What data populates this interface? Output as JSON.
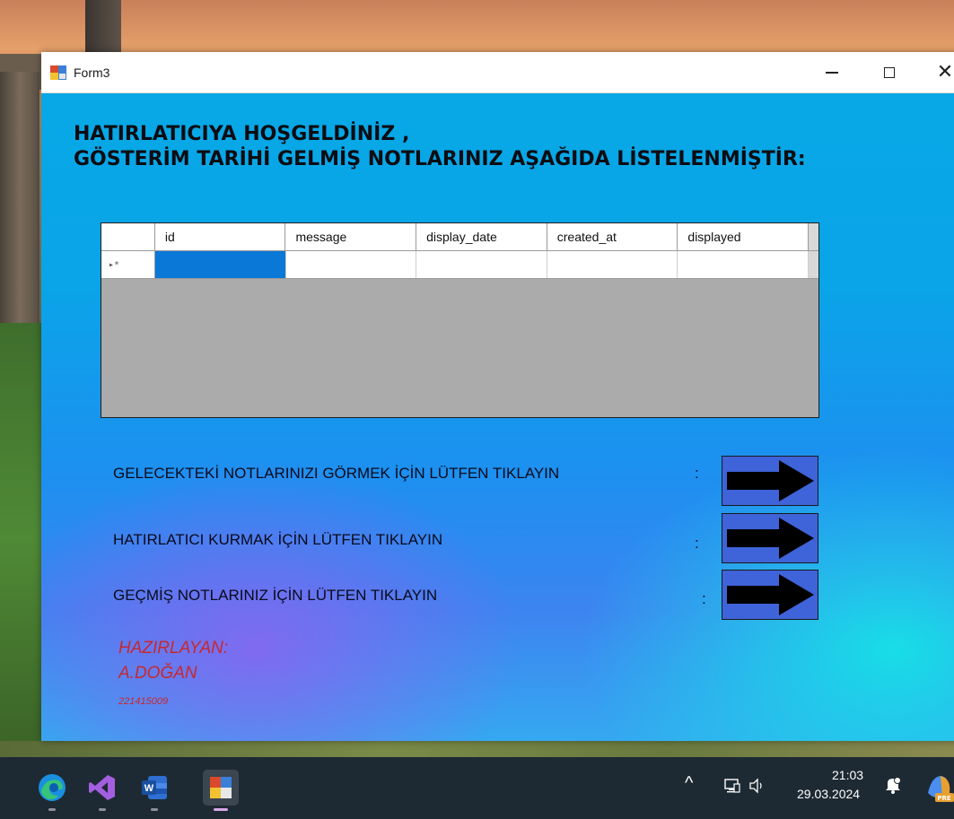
{
  "window": {
    "title": "Form3"
  },
  "heading": {
    "line1": "HATIRLATICIYA HOŞGELDİNİZ ,",
    "line2": "GÖSTERİM TARİHİ GELMİŞ NOTLARINIZ AŞAĞIDA LİSTELENMİŞTİR:"
  },
  "grid": {
    "columns": [
      "id",
      "message",
      "display_date",
      "created_at",
      "displayed"
    ],
    "new_row_marker": "▸*"
  },
  "actions": [
    {
      "label": "GELECEKTEKİ NOTLARINIZI GÖRMEK İÇİN LÜTFEN TIKLAYIN",
      "colon": ":"
    },
    {
      "label": "HATIRLATICI KURMAK İÇİN LÜTFEN TIKLAYIN",
      "colon": ":"
    },
    {
      "label": "GEÇMİŞ NOTLARINIZ İÇİN LÜTFEN TIKLAYIN",
      "colon": ":"
    }
  ],
  "author": {
    "line1": "HAZIRLAYAN:",
    "line2": "A.DOĞAN",
    "line3": "221415009"
  },
  "taskbar": {
    "apps": [
      "edge-icon",
      "visual-studio-icon",
      "word-icon",
      "winforms-app-icon"
    ],
    "time": "21:03",
    "date": "29.03.2024",
    "tray_chevron": "^"
  },
  "colors": {
    "arrow_button": "#3f63d8",
    "grid_selection": "#0a78d7",
    "author_text": "#c8282e"
  }
}
